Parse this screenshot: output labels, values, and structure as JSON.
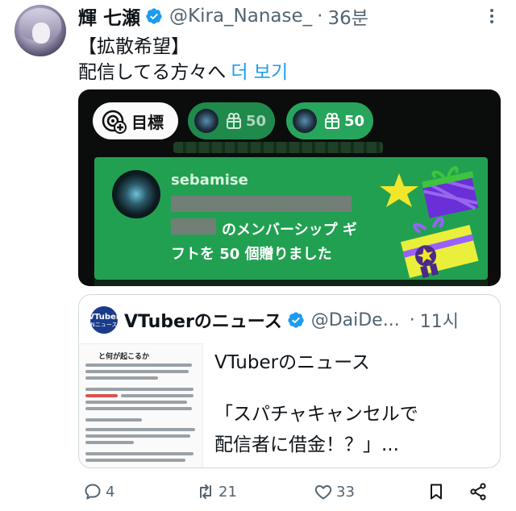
{
  "tweet": {
    "author_name": "輝 七瀬",
    "handle": "@Kira_Nanase_",
    "separator": "·",
    "time": "36분",
    "text_line1": "【拡散希望】",
    "text_line2": "配信してる方々へ",
    "show_more": "더 보기"
  },
  "media": {
    "goal_label": "目標",
    "gift_count_1": "50",
    "gift_count_2": "50",
    "sender_name": "sebamise",
    "message_line1": "のメンバーシップ ギ",
    "message_line2": "フトを 50 個贈りました"
  },
  "quote": {
    "avatar_text_1": "VTuber",
    "avatar_text_2": "Nニュース",
    "name": "VTuberのニュース",
    "handle": "@DaiDe...",
    "separator": "·",
    "time": "11시",
    "thumb_heading": "と何が起こるか",
    "title": "VTuberのニュース",
    "body_line1": "「スパチャキャンセルで",
    "body_line2": "配信者に借金！？」..."
  },
  "actions": {
    "reply_count": "4",
    "retweet_count": "21",
    "like_count": "33"
  },
  "colors": {
    "verified": "#1d9bf0",
    "link": "#1d9bf0",
    "secondary_text": "#536471",
    "gift_panel": "#22a052"
  }
}
